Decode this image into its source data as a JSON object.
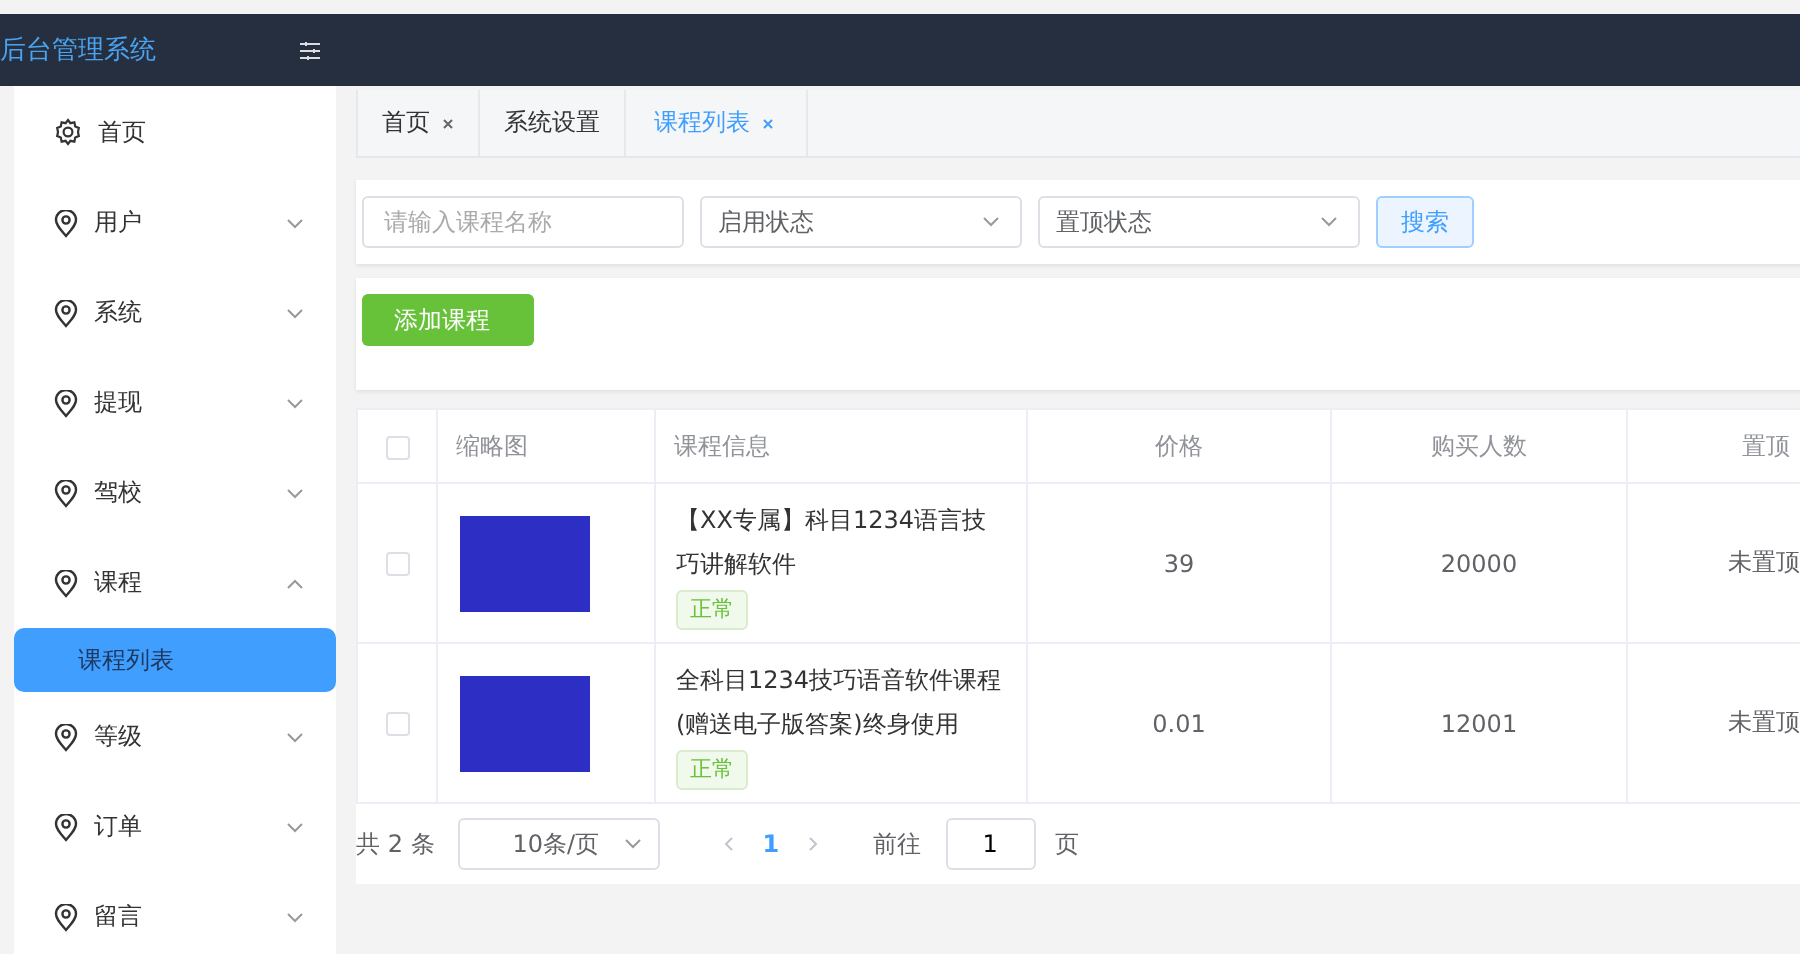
{
  "header": {
    "title": "后台管理系统"
  },
  "sidebar": {
    "items": [
      {
        "label": "首页",
        "kind": "link"
      },
      {
        "label": "用户",
        "kind": "group",
        "expanded": false
      },
      {
        "label": "系统",
        "kind": "group",
        "expanded": false
      },
      {
        "label": "提现",
        "kind": "group",
        "expanded": false
      },
      {
        "label": "驾校",
        "kind": "group",
        "expanded": false
      },
      {
        "label": "课程",
        "kind": "group",
        "expanded": true,
        "children": [
          {
            "label": "课程列表",
            "selected": true
          }
        ]
      },
      {
        "label": "等级",
        "kind": "group",
        "expanded": false
      },
      {
        "label": "订单",
        "kind": "group",
        "expanded": false
      },
      {
        "label": "留言",
        "kind": "group",
        "expanded": false
      }
    ]
  },
  "tabs": [
    {
      "label": "首页",
      "closable": true,
      "selected": false
    },
    {
      "label": "系统设置",
      "closable": false,
      "selected": false
    },
    {
      "label": "课程列表",
      "closable": true,
      "selected": true
    }
  ],
  "filters": {
    "search": {
      "placeholder": "请输入课程名称"
    },
    "selects": [
      {
        "placeholder": "启用状态"
      },
      {
        "placeholder": "置顶状态"
      }
    ],
    "button": "搜索"
  },
  "add_button": "添加课程",
  "table": {
    "header_checked": false,
    "columns": [
      "缩略图",
      "课程信息",
      "价格",
      "购买人数",
      "置顶"
    ],
    "rows": [
      {
        "checked": false,
        "title": "【XX专属】科目1234语言技巧讲解软件",
        "status": "正常",
        "price": "39",
        "buyers": "20000",
        "pinned": "未置顶"
      },
      {
        "checked": false,
        "title": "全科目1234技巧语音软件课程(赠送电子版答案)终身使用",
        "status": "正常",
        "price": "0.01",
        "buyers": "12001",
        "pinned": "未置顶"
      }
    ]
  },
  "pager": {
    "total": "共 2 条",
    "page_size": "10条/页",
    "pages": [
      {
        "label": "1",
        "selected": true
      }
    ],
    "goto_label": "前往",
    "goto_value": "1",
    "goto_suffix": "页"
  }
}
